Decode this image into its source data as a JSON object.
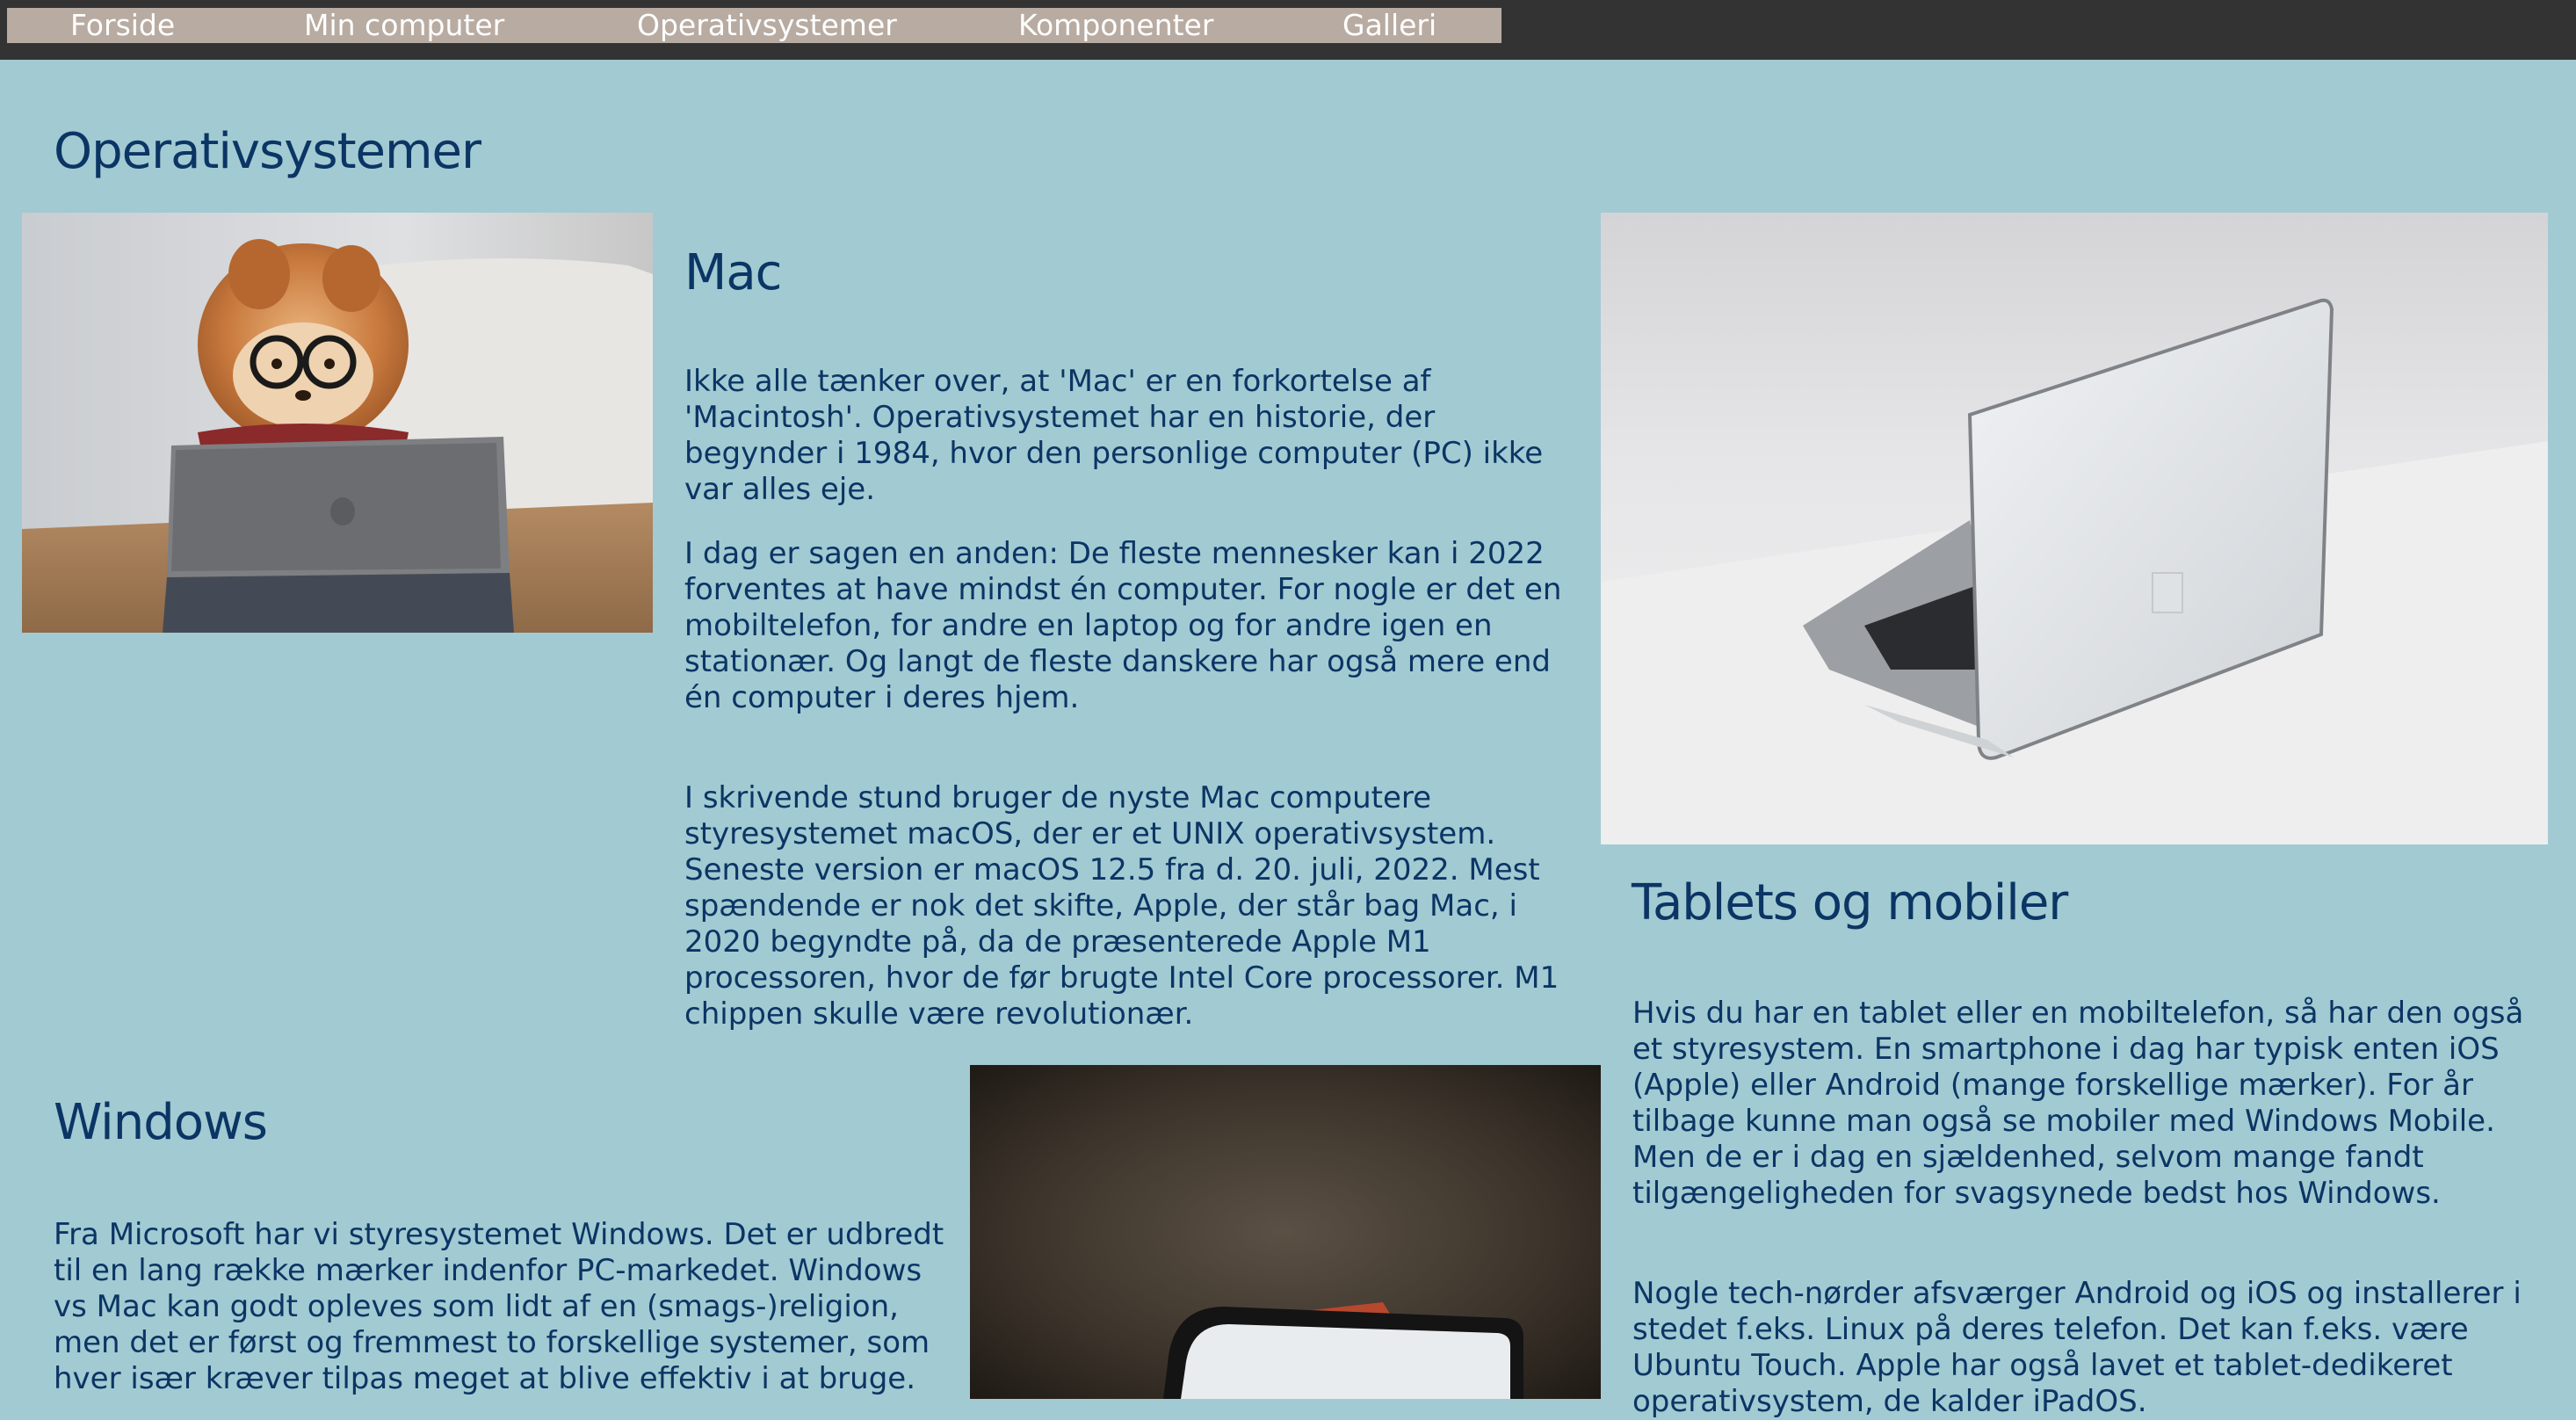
{
  "nav": {
    "items": [
      "Forside",
      "Min computer",
      "Operativsystemer",
      "Komponenter",
      "Galleri"
    ]
  },
  "page_title": "Operativsystemer",
  "mac": {
    "heading": "Mac",
    "paragraphs": [
      "Ikke alle tænker over, at 'Mac' er en forkortelse af 'Macintosh'. Operativsystemet har en historie, der begynder i 1984, hvor den personlige computer (PC) ikke var alles eje.",
      "I dag er sagen en anden: De fleste mennesker kan i 2022 forventes at have mindst én computer. For nogle er det en mobiltelefon, for andre en laptop og for andre igen en stationær. Og langt de fleste danskere har også mere end én computer i deres hjem.",
      "I skrivende stund bruger de nyste Mac computere styresystemet macOS, der er et UNIX operativsystem. Seneste version er macOS 12.5 fra d. 20. juli, 2022. Mest spændende er nok det skifte, Apple, der står bag Mac, i 2020 begyndte på, da de præsenterede Apple M1 processoren, hvor de før brugte Intel Core processorer. M1 chippen skulle være revolutionær."
    ]
  },
  "tablets": {
    "heading": "Tablets og mobiler",
    "paragraphs": [
      "Hvis du har en tablet eller en mobiltelefon, så har den også et styresystem. En smartphone i dag har typisk enten iOS (Apple) eller Android (mange forskellige mærker). For år tilbage kunne man også se mobiler med Windows Mobile. Men de er i dag en sjældenhed, selvom mange fandt tilgængeligheden for svagsynede bedst hos Windows.",
      "Nogle tech-nørder afsværger Android og iOS og installerer i stedet f.eks. Linux på deres telefon. Det kan f.eks. være Ubuntu Touch. Apple har også lavet et tablet-dedikeret operativsystem, de kalder iPadOS."
    ]
  },
  "windows": {
    "heading": "Windows",
    "paragraphs": [
      "Fra Microsoft har vi styresystemet Windows. Det er udbredt til en lang række mærker indenfor PC-markedet. Windows vs Mac kan godt opleves som lidt af en (smags-)religion, men det er først og fremmest to forskellige systemer, som hver især kræver tilpas meget at blive effektiv i at bruge."
    ]
  }
}
